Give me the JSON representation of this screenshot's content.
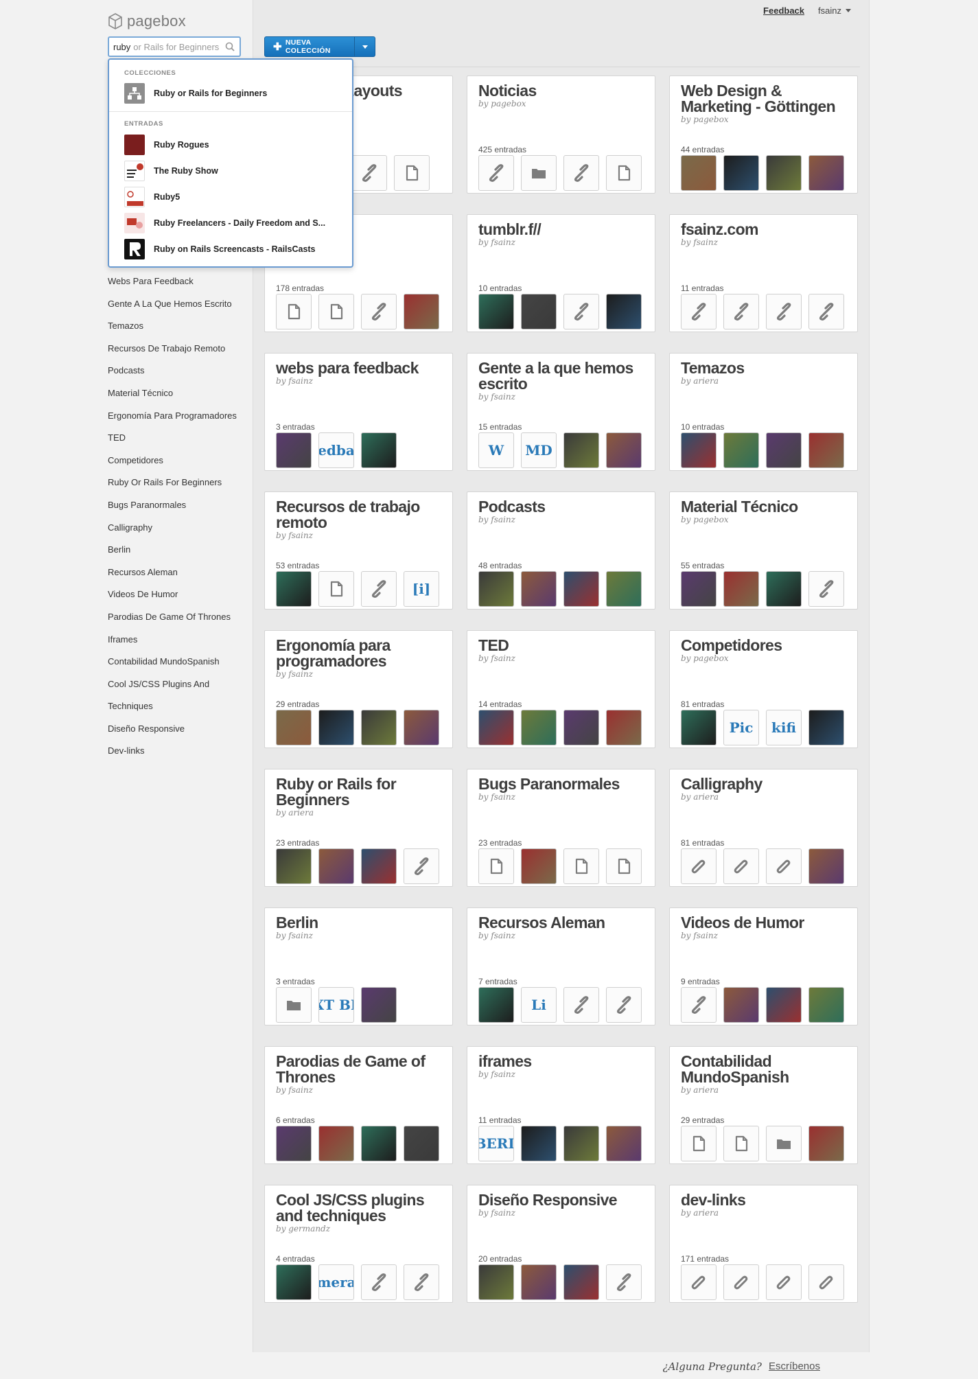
{
  "app": {
    "name": "pagebox"
  },
  "search": {
    "typed": "ruby",
    "suggestion": "or Rails for Beginners"
  },
  "dropdown": {
    "collections_label": "COLECCIONES",
    "collections": [
      {
        "label": "Ruby or Rails for Beginners"
      }
    ],
    "entries_label": "ENTRADAS",
    "entries": [
      {
        "label": "Ruby Rogues"
      },
      {
        "label": "The Ruby Show"
      },
      {
        "label": "Ruby5"
      },
      {
        "label": "Ruby Freelancers - Daily Freedom and S..."
      },
      {
        "label": "Ruby on Rails Screencasts - RailsCasts"
      }
    ]
  },
  "header": {
    "feedback": "Feedback",
    "user": "fsainz",
    "new_button": "NUEVA COLECCIÓN"
  },
  "sidebar": {
    "items": [
      "Webs Para Feedback",
      "Gente A La Que Hemos Escrito",
      "Temazos",
      "Recursos De Trabajo Remoto",
      "Podcasts",
      "Material Técnico",
      "Ergonomía Para Programadores",
      "TED",
      "Competidores",
      "Ruby Or Rails For Beginners",
      "Bugs Paranormales",
      "Calligraphy",
      "Berlin",
      "Recursos Aleman",
      "Videos De Humor",
      "Parodias De Game Of Thrones",
      "Iframes",
      "Contabilidad MundoSpanish",
      "Cool JS/CSS Plugins And",
      "Techniques",
      "Diseño Responsive",
      "Dev-links"
    ]
  },
  "cards": [
    {
      "title": "Masonry Layouts",
      "by": "",
      "count": "",
      "thumbs": [
        "link",
        "doc"
      ]
    },
    {
      "title": "Noticias",
      "by": "by pagebox",
      "count": "425 entradas",
      "thumbs": [
        "link",
        "folder",
        "link",
        "doc"
      ]
    },
    {
      "title": "Web Design & Marketing - Göttingen",
      "by": "by pagebox",
      "count": "44 entradas",
      "thumbs": [
        "img",
        "img",
        "img",
        "img"
      ]
    },
    {
      "title": "",
      "by": "",
      "count": "178 entradas",
      "thumbs": [
        "doc",
        "doc",
        "link",
        "img"
      ]
    },
    {
      "title": "tumblr.f//",
      "by": "by fsainz",
      "count": "10 entradas",
      "thumbs": [
        "img",
        "img",
        "link",
        "img"
      ]
    },
    {
      "title": "fsainz.com",
      "by": "by fsainz",
      "count": "11 entradas",
      "thumbs": [
        "link",
        "link",
        "link",
        "link"
      ]
    },
    {
      "title": "webs para feedback",
      "by": "by fsainz",
      "count": "3 entradas",
      "thumbs": [
        "img",
        "text:edba",
        "img"
      ]
    },
    {
      "title": "Gente a la que hemos escrito",
      "by": "by fsainz",
      "count": "15 entradas",
      "thumbs": [
        "text:W",
        "text:MD",
        "img",
        "img"
      ]
    },
    {
      "title": "Temazos",
      "by": "by ariera",
      "count": "10 entradas",
      "thumbs": [
        "img",
        "img",
        "img",
        "img"
      ]
    },
    {
      "title": "Recursos de trabajo remoto",
      "by": "by fsainz",
      "count": "53 entradas",
      "thumbs": [
        "img",
        "doc",
        "link",
        "text:[i]"
      ]
    },
    {
      "title": "Podcasts",
      "by": "by fsainz",
      "count": "48 entradas",
      "thumbs": [
        "img",
        "img",
        "img",
        "img"
      ]
    },
    {
      "title": "Material Técnico",
      "by": "by pagebox",
      "count": "55 entradas",
      "thumbs": [
        "img",
        "img",
        "img",
        "link"
      ]
    },
    {
      "title": "Ergonomía para programadores",
      "by": "by fsainz",
      "count": "29 entradas",
      "thumbs": [
        "img",
        "img",
        "img",
        "img"
      ]
    },
    {
      "title": "TED",
      "by": "by fsainz",
      "count": "14 entradas",
      "thumbs": [
        "img",
        "img",
        "img",
        "img"
      ]
    },
    {
      "title": "Competidores",
      "by": "by pagebox",
      "count": "81 entradas",
      "thumbs": [
        "img",
        "text:Pic",
        "text:kifi",
        "img"
      ]
    },
    {
      "title": "Ruby or Rails for Beginners",
      "by": "by ariera",
      "count": "23 entradas",
      "thumbs": [
        "img",
        "img",
        "img",
        "link"
      ]
    },
    {
      "title": "Bugs Paranormales",
      "by": "by fsainz",
      "count": "23 entradas",
      "thumbs": [
        "doc",
        "img",
        "doc",
        "doc"
      ]
    },
    {
      "title": "Calligraphy",
      "by": "by ariera",
      "count": "81 entradas",
      "thumbs": [
        "clip",
        "clip",
        "clip",
        "img"
      ]
    },
    {
      "title": "Berlin",
      "by": "by fsainz",
      "count": "3 entradas",
      "thumbs": [
        "folder",
        "text:NEXT BERL",
        "img"
      ]
    },
    {
      "title": "Recursos Aleman",
      "by": "by fsainz",
      "count": "7 entradas",
      "thumbs": [
        "img",
        "text:Li",
        "link",
        "link"
      ]
    },
    {
      "title": "Videos de Humor",
      "by": "by fsainz",
      "count": "9 entradas",
      "thumbs": [
        "link",
        "img",
        "img",
        "img"
      ]
    },
    {
      "title": "Parodias de Game of Thrones",
      "by": "by fsainz",
      "count": "6 entradas",
      "thumbs": [
        "img",
        "img",
        "img",
        "img"
      ]
    },
    {
      "title": "iframes",
      "by": "by fsainz",
      "count": "11 entradas",
      "thumbs": [
        "text:BERL",
        "img",
        "img",
        "img"
      ]
    },
    {
      "title": "Contabilidad MundoSpanish",
      "by": "by ariera",
      "count": "29 entradas",
      "thumbs": [
        "doc",
        "doc",
        "folder",
        "img"
      ]
    },
    {
      "title": "Cool JS/CSS plugins and techniques",
      "by": "by germandz",
      "count": "4 entradas",
      "thumbs": [
        "img",
        "text:Numeral.js",
        "link",
        "link"
      ]
    },
    {
      "title": "Diseño Responsive",
      "by": "by fsainz",
      "count": "20 entradas",
      "thumbs": [
        "img",
        "img",
        "img",
        "link"
      ]
    },
    {
      "title": "dev-links",
      "by": "by ariera",
      "count": "171 entradas",
      "thumbs": [
        "clip",
        "clip",
        "clip",
        "clip"
      ]
    }
  ],
  "footer": {
    "question": "¿Alguna Pregunta?",
    "link": "Escríbenos"
  },
  "colors": {
    "accent": "#1f7fc8",
    "dropdown_border": "#6a9bd1"
  }
}
